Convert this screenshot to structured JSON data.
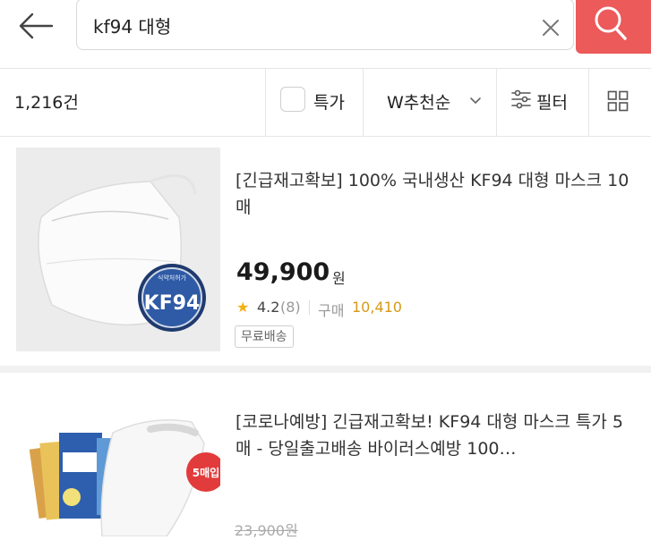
{
  "search": {
    "query": "kf94 대형"
  },
  "filter_bar": {
    "result_count": "1,216건",
    "special_label": "특가",
    "sort_label": "W추천순",
    "filter_label": "필터"
  },
  "products": [
    {
      "title": "[긴급재고확보] 100% 국내생산 KF94 대형 마스크 10매",
      "price": "49,900",
      "currency": "원",
      "rating": "4.2",
      "review_count": "(8)",
      "purchase_label": "구매",
      "purchase_count": "10,410",
      "shipping_badge": "무료배송",
      "badge_text": "KF94",
      "badge_subtext": "식약처허가"
    },
    {
      "title": "[코로나예방] 긴급재고확보! KF94 대형 마스크 특가 5매 - 당일출고배송 바이러스예방 100…",
      "old_price": "23,900원",
      "pack_badge": "5매입"
    }
  ],
  "colors": {
    "search_button": "#ec5a5a",
    "star": "#f2b011",
    "purchase_count": "#d59a16"
  }
}
